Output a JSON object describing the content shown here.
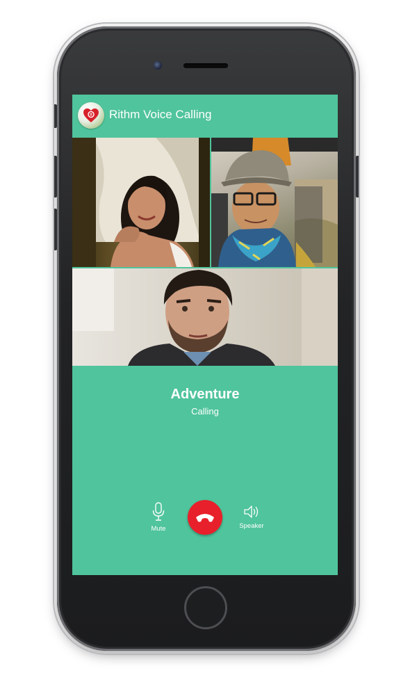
{
  "app_bar": {
    "title": "Rithm Voice Calling",
    "logo_icon": "heart-logo-icon"
  },
  "participants": [
    {
      "name": "",
      "tile": "participant-video-1"
    },
    {
      "name": "",
      "tile": "participant-video-2"
    },
    {
      "name": "",
      "tile": "participant-video-3"
    }
  ],
  "call": {
    "contact_name": "Adventure",
    "status": "Calling"
  },
  "controls": {
    "mute": {
      "label": "Mute",
      "icon": "microphone-icon"
    },
    "end_call": {
      "icon": "phone-hangup-icon",
      "color": "#e8202b"
    },
    "speaker": {
      "label": "Speaker",
      "icon": "speaker-icon"
    }
  },
  "colors": {
    "accent": "#50c49c",
    "end_call": "#e8202b",
    "text": "#ffffff"
  }
}
